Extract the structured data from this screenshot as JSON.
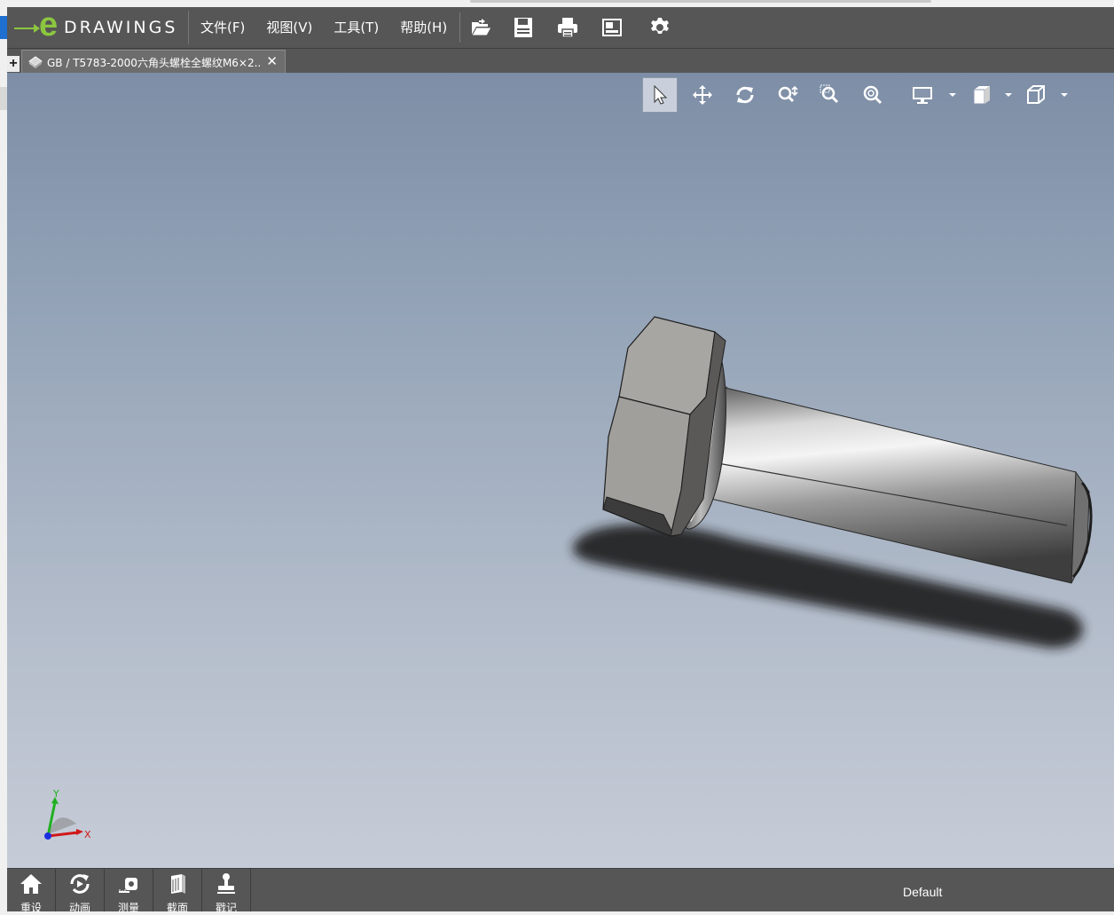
{
  "app": {
    "logo_letter": "e",
    "logo_text": "DRAWINGS",
    "colors": {
      "brand_green": "#8cc63f",
      "chrome": "#565656",
      "viewport_top": "#7d8ea6",
      "viewport_bottom": "#c6ccd7"
    }
  },
  "menu": {
    "items": [
      {
        "label": "文件(F)"
      },
      {
        "label": "视图(V)"
      },
      {
        "label": "工具(T)"
      },
      {
        "label": "帮助(H)"
      }
    ]
  },
  "toolbar": {
    "icons": [
      "open-icon",
      "save-icon",
      "print-icon",
      "sheet-icon",
      "gear-icon"
    ]
  },
  "tabs": {
    "add_label": "+",
    "document_title": "GB / T5783-2000六角头螺栓全螺纹M6×2...",
    "close_label": "✕"
  },
  "view_tools": {
    "icons": [
      "select-icon",
      "pan-icon",
      "rotate-icon",
      "zoom-icon",
      "zoom-area-icon",
      "zoom-fit-icon",
      "display-style-icon",
      "view-orientation-icon",
      "box-view-icon"
    ],
    "active": "select-icon"
  },
  "triad": {
    "y_label": "Y",
    "x_label": "X"
  },
  "bottom": {
    "buttons": [
      {
        "label": "重设",
        "icon": "home-icon"
      },
      {
        "label": "动画",
        "icon": "animate-icon"
      },
      {
        "label": "测量",
        "icon": "measure-icon"
      },
      {
        "label": "截面",
        "icon": "section-icon"
      },
      {
        "label": "戳记",
        "icon": "stamp-icon"
      }
    ],
    "configuration": "Default"
  }
}
